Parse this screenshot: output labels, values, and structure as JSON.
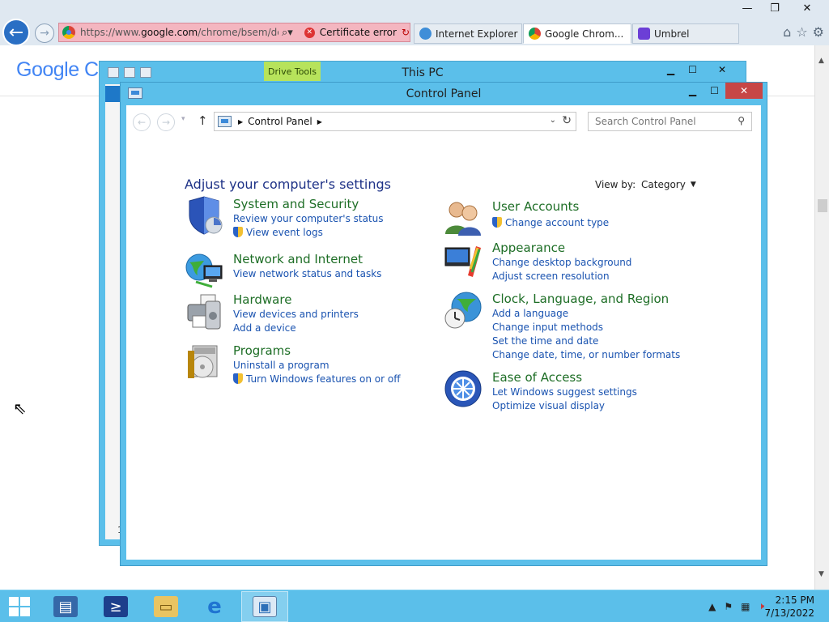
{
  "browser": {
    "window_controls": [
      "—",
      "❐",
      "✕"
    ],
    "url_prefix": "https://www.",
    "url_domain": "google.com",
    "url_path": "/chrome/bsem/dowr",
    "cert_error": "Certificate error",
    "tabs": [
      {
        "label": "Internet Explorer E...",
        "icon": "ie-icon"
      },
      {
        "label": "Google Chrom...",
        "icon": "chrome-icon",
        "active": true
      },
      {
        "label": "Umbrel",
        "icon": "umbrel-icon"
      }
    ],
    "page_logo": "Google Ch",
    "colors": {
      "ie_bar": "#dfe8f1",
      "cert_error_bg": "#f4b6c0"
    }
  },
  "this_pc": {
    "title": "This PC",
    "ribbon_context": "Drive Tools",
    "status_fragment": "1"
  },
  "control_panel": {
    "title": "Control Panel",
    "breadcrumb": "Control Panel",
    "search_placeholder": "Search Control Panel",
    "heading": "Adjust your computer's settings",
    "view_by_label": "View by:",
    "view_by_value": "Category",
    "categories_left": [
      {
        "title": "System and Security",
        "icon": "shield-icon",
        "links": [
          {
            "label": "Review your computer's status"
          },
          {
            "label": "View event logs",
            "uac": true
          }
        ]
      },
      {
        "title": "Network and Internet",
        "icon": "globe-network-icon",
        "links": [
          {
            "label": "View network status and tasks"
          }
        ]
      },
      {
        "title": "Hardware",
        "icon": "printer-icon",
        "links": [
          {
            "label": "View devices and printers"
          },
          {
            "label": "Add a device"
          }
        ]
      },
      {
        "title": "Programs",
        "icon": "programs-icon",
        "links": [
          {
            "label": "Uninstall a program"
          },
          {
            "label": "Turn Windows features on or off",
            "uac": true
          }
        ]
      }
    ],
    "categories_right": [
      {
        "title": "User Accounts",
        "icon": "users-icon",
        "links": [
          {
            "label": "Change account type",
            "uac": true
          }
        ]
      },
      {
        "title": "Appearance",
        "icon": "appearance-icon",
        "links": [
          {
            "label": "Change desktop background"
          },
          {
            "label": "Adjust screen resolution"
          }
        ]
      },
      {
        "title": "Clock, Language, and Region",
        "icon": "clock-globe-icon",
        "links": [
          {
            "label": "Add a language"
          },
          {
            "label": "Change input methods"
          },
          {
            "label": "Set the time and date"
          },
          {
            "label": "Change date, time, or number formats"
          }
        ]
      },
      {
        "title": "Ease of Access",
        "icon": "ease-of-access-icon",
        "links": [
          {
            "label": "Let Windows suggest settings"
          },
          {
            "label": "Optimize visual display"
          }
        ]
      }
    ],
    "colors": {
      "frame": "#5bbfea",
      "category_title": "#1e6e26",
      "link": "#1a53b0",
      "heading": "#1e3287"
    }
  },
  "taskbar": {
    "apps": [
      {
        "name": "server-manager",
        "icon": "server-manager-icon"
      },
      {
        "name": "powershell",
        "icon": "powershell-icon"
      },
      {
        "name": "file-explorer",
        "icon": "folder-icon"
      },
      {
        "name": "internet-explorer",
        "icon": "ie-icon"
      },
      {
        "name": "control-panel",
        "icon": "control-panel-icon",
        "active": true
      }
    ],
    "time": "2:15 PM",
    "date": "7/13/2022"
  }
}
